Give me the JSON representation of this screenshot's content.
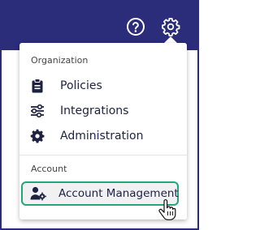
{
  "colors": {
    "topbar": "#2b2c7a",
    "highlight_border": "#22a67a",
    "text": "#1e2240"
  },
  "topbar": {
    "icons": [
      "help-icon",
      "gear-icon"
    ]
  },
  "menu": {
    "organization_header": "Organization",
    "account_header": "Account",
    "items": [
      {
        "label": "Policies",
        "icon": "clipboard-icon"
      },
      {
        "label": "Integrations",
        "icon": "sliders-icon"
      },
      {
        "label": "Administration",
        "icon": "gear-icon"
      },
      {
        "label": "Account Management",
        "icon": "user-gear-icon"
      }
    ]
  }
}
